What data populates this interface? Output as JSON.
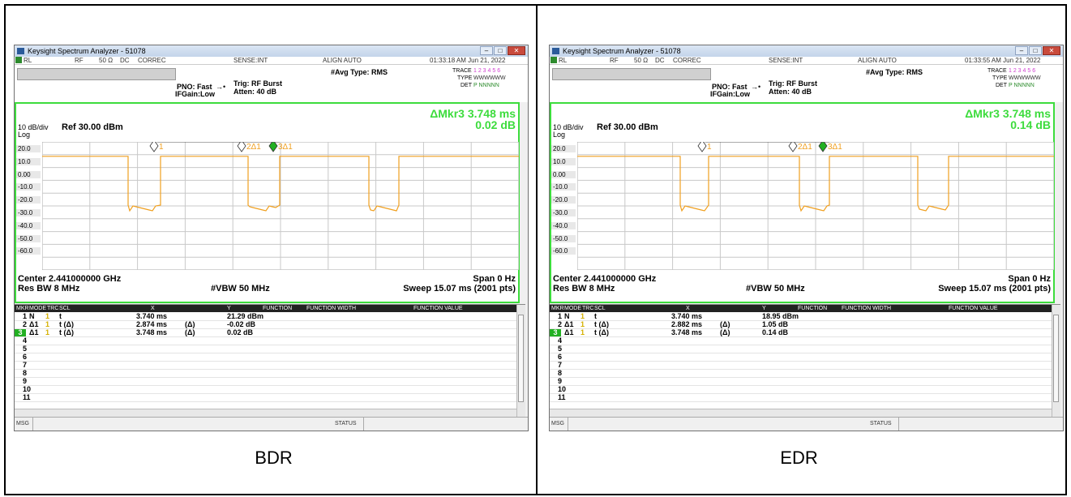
{
  "captions": {
    "left": "BDR",
    "right": "EDR"
  },
  "common": {
    "app_title": "Keysight Spectrum Analyzer - 51078",
    "status_bar": {
      "rl": "RL",
      "rf": "RF",
      "impedance": "50 Ω",
      "coupling": "DC",
      "correc": "CORREC",
      "sense": "SENSE:INT",
      "align": "ALIGN AUTO"
    },
    "pno": "PNO: Fast",
    "ifgain": "IFGain:Low",
    "trig": "Trig: RF Burst",
    "atten": "Atten: 40 dB",
    "avg_type": "#Avg Type: RMS",
    "trace_label": "TRACE",
    "trace_nums": "1 2 3 4 5 6",
    "type_label": "TYPE",
    "type_val": "WWWWWW",
    "det_label": "DET",
    "det_val": "P NNNNN",
    "scale": "10 dB/div",
    "ref": "Ref 30.00 dBm",
    "log": "Log",
    "center": "Center 2.441000000 GHz",
    "span": "Span 0 Hz",
    "res_bw": "Res BW 8 MHz",
    "vbw": "#VBW 50 MHz",
    "sweep": "Sweep  15.07 ms (2001 pts)",
    "y_ticks": [
      "20.0",
      "10.0",
      "0.00",
      "-10.0",
      "-20.0",
      "-30.0",
      "-40.0",
      "-50.0",
      "-60.0"
    ],
    "table_headers": [
      "MKR",
      "MODE",
      "TRC",
      "SCL",
      "X",
      "Y",
      "FUNCTION",
      "FUNCTION WIDTH",
      "FUNCTION VALUE"
    ],
    "row_numbers": [
      "1",
      "2",
      "3",
      "4",
      "5",
      "6",
      "7",
      "8",
      "9",
      "10",
      "11"
    ],
    "msg": "MSG",
    "status": "STATUS",
    "colors": {
      "trace": "#f0a020",
      "frame": "#3ddc3d",
      "active_marker": "#22b022"
    }
  },
  "left": {
    "time": "01:33:18 AM Jun 21, 2022",
    "delta_marker": "ΔMkr3 3.748 ms",
    "delta_value": "0.02 dB",
    "markers": [
      "1",
      "2Δ1",
      "3Δ1"
    ],
    "rows": [
      {
        "mode": "N",
        "trc": "1",
        "scl": "t",
        "x": "3.740 ms",
        "xd": "",
        "y": "21.29 dBm"
      },
      {
        "mode": "Δ1",
        "trc": "1",
        "scl": "t  (Δ)",
        "x": "2.874 ms",
        "xd": "(Δ)",
        "y": "-0.02 dB"
      },
      {
        "mode": "Δ1",
        "trc": "1",
        "scl": "t  (Δ)",
        "x": "3.748 ms",
        "xd": "(Δ)",
        "y": "0.02 dB"
      }
    ]
  },
  "right": {
    "time": "01:33:55 AM Jun 21, 2022",
    "delta_marker": "ΔMkr3 3.748 ms",
    "delta_value": "0.14 dB",
    "markers": [
      "1",
      "2Δ1",
      "3Δ1"
    ],
    "rows": [
      {
        "mode": "N",
        "trc": "1",
        "scl": "t",
        "x": "3.740 ms",
        "xd": "",
        "y": "18.95 dBm"
      },
      {
        "mode": "Δ1",
        "trc": "1",
        "scl": "t  (Δ)",
        "x": "2.882 ms",
        "xd": "(Δ)",
        "y": "1.05 dB"
      },
      {
        "mode": "Δ1",
        "trc": "1",
        "scl": "t  (Δ)",
        "x": "3.748 ms",
        "xd": "(Δ)",
        "y": "0.14 dB"
      }
    ]
  }
}
